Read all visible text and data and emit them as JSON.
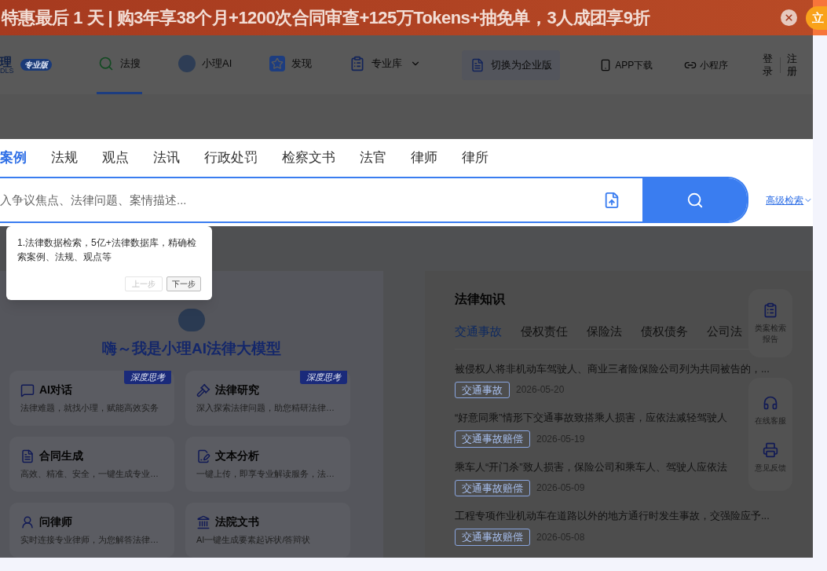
{
  "banner": {
    "text": "特惠最后 1 天 | 购3年享38个月+1200次合同审查+125万Tokens+抽免单，3人成团享9折",
    "cta": "立"
  },
  "header": {
    "logo": "理",
    "logo_sub": "DLS",
    "edition": "专业版",
    "nav": [
      {
        "label": "法搜",
        "selected": true,
        "dropdown": false
      },
      {
        "label": "小理AI",
        "selected": false,
        "dropdown": false
      },
      {
        "label": "发现",
        "selected": false,
        "dropdown": false
      },
      {
        "label": "专业库",
        "selected": false,
        "dropdown": true
      }
    ],
    "enterprise_button": "切换为企业版",
    "links": [
      "APP下载",
      "小程序"
    ],
    "login": "登录",
    "register": "注册"
  },
  "search": {
    "tabs": [
      {
        "label": "案例",
        "selected": true
      },
      {
        "label": "法规",
        "selected": false
      },
      {
        "label": "观点",
        "selected": false
      },
      {
        "label": "法讯",
        "selected": false
      },
      {
        "label": "行政处罚",
        "selected": false
      },
      {
        "label": "检察文书",
        "selected": false
      },
      {
        "label": "法官",
        "selected": false
      },
      {
        "label": "律师",
        "selected": false
      },
      {
        "label": "律所",
        "selected": false
      }
    ],
    "placeholder": "入争议焦点、法律问题、案情描述...",
    "advanced": "高级检索"
  },
  "tour": {
    "text": "1.法律数据检索，5亿+法律数据库，精确检索案例、法规、观点等",
    "prev": {
      "label": "上一步",
      "disabled": true
    },
    "next": {
      "label": "下一步",
      "disabled": false
    }
  },
  "ai_panel": {
    "title": "嗨～我是小理AI法律大模型",
    "cards": [
      {
        "title": "AI对话",
        "desc": "法律难题，就找小理，赋能高效实务",
        "badge": "深度思考"
      },
      {
        "title": "法律研究",
        "desc": "深入探索法律问题，助您精研法律…",
        "badge": "深度思考"
      },
      {
        "title": "合同生成",
        "desc": "高效、精准、安全，一键生成专业…"
      },
      {
        "title": "文本分析",
        "desc": "一键上传，即享专业解读服务，法…"
      },
      {
        "title": "问律师",
        "desc": "实时连接专业律师，为您解答法律…"
      },
      {
        "title": "法院文书",
        "desc": "AI一键生成要素起诉状/答辩状"
      }
    ]
  },
  "knowledge": {
    "title": "法律知识",
    "tabs": [
      {
        "label": "交通事故",
        "selected": true
      },
      {
        "label": "侵权责任",
        "selected": false
      },
      {
        "label": "保险法",
        "selected": false
      },
      {
        "label": "债权债务",
        "selected": false
      },
      {
        "label": "公司法",
        "selected": false
      }
    ],
    "items": [
      {
        "title": "被侵权人将非机动车驾驶人、商业三者险保险公司列为共同被告的，...",
        "tag": "交通事故",
        "date": "2026-05-20"
      },
      {
        "title": "“好意同乘”情形下交通事故致搭乘人损害，应依法减轻驾驶人",
        "tag": "交通事故赔偿",
        "date": "2026-05-19"
      },
      {
        "title": "乘车人“开门杀”致人损害，保险公司和乘车人、驾驶人应依法",
        "tag": "交通事故赔偿",
        "date": "2026-05-09"
      },
      {
        "title": "工程专项作业机动车在道路以外的地方通行时发生事故，交强险应予...",
        "tag": "交通事故赔偿",
        "date": "2026-05-08"
      }
    ]
  },
  "float_bar": [
    "类案检索报告",
    "在线客服",
    "意见反馈"
  ]
}
